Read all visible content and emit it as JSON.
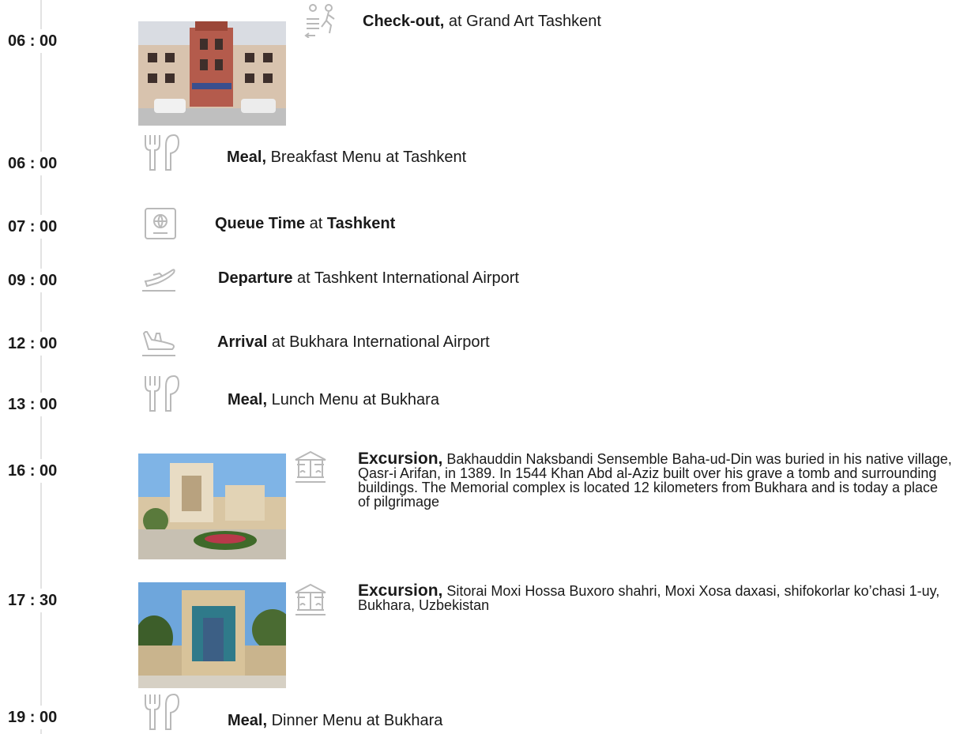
{
  "events": [
    {
      "time": "06 : 00",
      "title": "Check-out,",
      "text": " at Grand Art Tashkent",
      "icon": "check-out-icon"
    },
    {
      "time": "06 : 00",
      "title": "Meal,",
      "text": " Breakfast Menu at Tashkent",
      "icon": "meal-icon"
    },
    {
      "time": "07 : 00",
      "title": "Queue Time",
      "text_mid": " at ",
      "title2": "Tashkent",
      "icon": "passport-icon"
    },
    {
      "time": "09 : 00",
      "title": "Departure",
      "text": " at Tashkent International Airport",
      "icon": "departure-icon"
    },
    {
      "time": "12 : 00",
      "title": "Arrival",
      "text": " at Bukhara International Airport",
      "icon": "arrival-icon"
    },
    {
      "time": "13 : 00",
      "title": "Meal,",
      "text": " Lunch Menu at Bukhara",
      "icon": "meal-icon"
    },
    {
      "time": "16 : 00",
      "title": "Excursion,",
      "text": " Bakhauddin Naksbandi Sensemble Baha-ud-Din was buried in his native village, Qasr-i Arifan, in 1389. In 1544 Khan Abd al-Aziz built over his grave a tomb and surrounding buildings. The Memorial complex is located 12 kilometers from Bukhara and is today a place of pilgrimage",
      "icon": "carousel-icon"
    },
    {
      "time": "17 : 30",
      "title": "Excursion,",
      "text": " Sitorai Moxi Hossa Buxoro shahri, Moxi Xosa daxasi, shifokorlar ko’chasi 1-uy, Bukhara, Uzbekistan",
      "icon": "carousel-icon"
    },
    {
      "time": "19 : 00",
      "title": "Meal,",
      "text": " Dinner Menu at Bukhara",
      "icon": "meal-icon"
    }
  ],
  "colors": {
    "icon": "#b9b9b9",
    "line": "#e3e3e3",
    "text": "#1a1a1a"
  }
}
